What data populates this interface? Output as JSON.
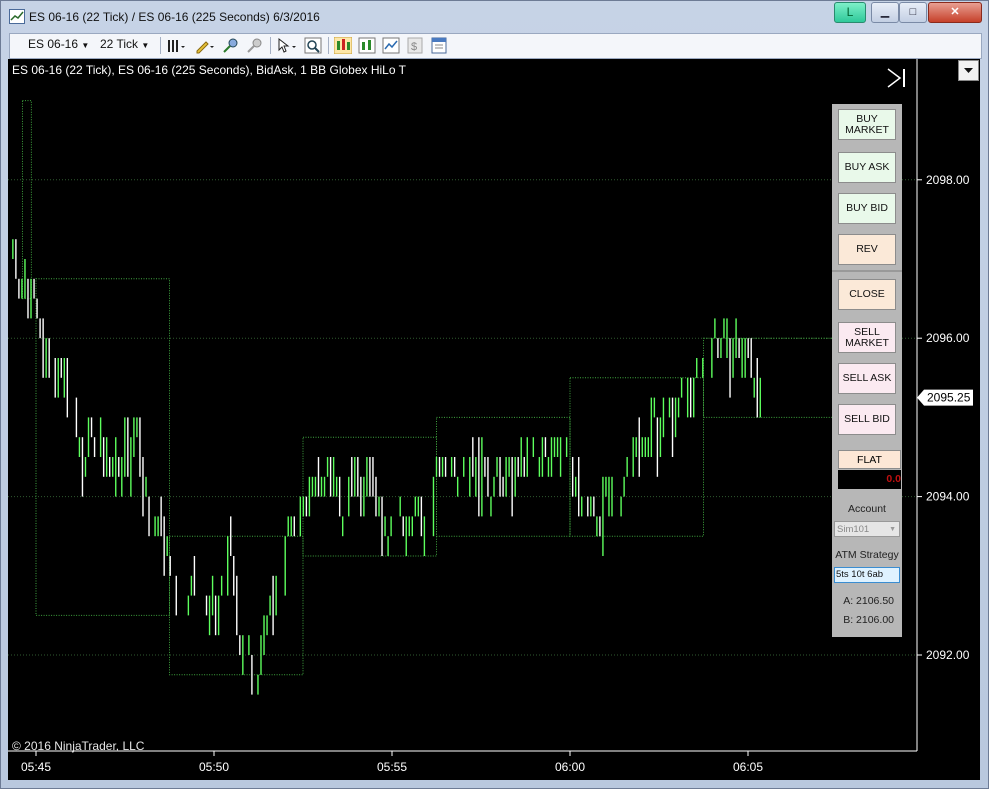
{
  "window": {
    "title": "ES 06-16 (22 Tick) / ES 06-16 (225 Seconds)  6/3/2016",
    "badge": "L",
    "controls": {
      "minimize": "▁",
      "maximize": "□",
      "close": "✕"
    }
  },
  "toolbar": {
    "instrument": "ES 06-16",
    "interval": "22 Tick",
    "icons": [
      "bar-style-icon",
      "pencil-draw-icon",
      "zoom-in-icon",
      "zoom-out-icon",
      "pointer-icon",
      "magnify-icon",
      "chart-trader-icon",
      "indicators-icon",
      "strategies-icon",
      "dollar-icon",
      "properties-icon"
    ]
  },
  "chart_header": "ES 06-16 (22 Tick), ES 06-16 (225 Seconds), BidAsk, 1 BB Globex HiLo T",
  "copyright": "© 2016 NinjaTrader, LLC",
  "chart_trader": {
    "buy_market": "BUY MARKET",
    "buy_ask": "BUY ASK",
    "buy_bid": "BUY BID",
    "rev": "REV",
    "close": "CLOSE",
    "sell_market": "SELL MARKET",
    "sell_ask": "SELL ASK",
    "sell_bid": "SELL BID",
    "flat": "FLAT",
    "pnl": "0.0",
    "account_label": "Account",
    "account_value": "Sim101",
    "atm_label": "ATM Strategy",
    "atm_value": "5ts 10t  6ab",
    "ask_quote": "A: 2106.50",
    "bid_quote": "B: 2106.00"
  },
  "colors": {
    "up": "#5dff5d",
    "down": "#ffffff",
    "box": "#3fa53f",
    "grid": "#2f5a2f",
    "background": "#000000"
  },
  "chart_data": {
    "type": "bar",
    "title": "ES 06-16 (22 Tick), ES 06-16 (225 Seconds), BidAsk, 1 BB Globex HiLo T",
    "ylim": [
      2090.7,
      2100.0
    ],
    "y_ticks": [
      2092.0,
      2094.0,
      2096.0,
      2098.0
    ],
    "y_tick_labels": [
      "2092.00",
      "2094.00",
      "2096.00",
      "2098.00"
    ],
    "x_ticks": [
      "05:45",
      "05:50",
      "05:55",
      "06:00",
      "06:05"
    ],
    "x_tick_minutes": [
      45.0,
      50.0,
      55.0,
      60.0,
      65.0
    ],
    "last_price": 2095.25,
    "last_price_label": "2095.25",
    "grid": true,
    "boxes_225s": [
      {
        "start_min": 44.62,
        "end_min": 44.87,
        "low": 2096.5,
        "high": 2099.0
      },
      {
        "start_min": 45.0,
        "end_min": 48.75,
        "low": 2092.5,
        "high": 2096.75
      },
      {
        "start_min": 48.75,
        "end_min": 52.5,
        "low": 2091.75,
        "high": 2093.5
      },
      {
        "start_min": 52.5,
        "end_min": 56.25,
        "low": 2093.25,
        "high": 2094.75
      },
      {
        "start_min": 56.25,
        "end_min": 60.0,
        "low": 2093.5,
        "high": 2095.0
      },
      {
        "start_min": 60.0,
        "end_min": 63.75,
        "low": 2093.5,
        "high": 2095.5
      },
      {
        "start_min": 63.75,
        "end_min": 67.5,
        "low": 2095.0,
        "high": 2096.0
      }
    ],
    "tick_path": [
      {
        "t": 44.35,
        "p": 2097.25
      },
      {
        "t": 44.6,
        "p": 2096.5
      },
      {
        "t": 44.9,
        "p": 2096.75
      },
      {
        "t": 45.2,
        "p": 2095.75
      },
      {
        "t": 45.8,
        "p": 2095.5
      },
      {
        "t": 46.3,
        "p": 2094.5
      },
      {
        "t": 46.6,
        "p": 2094.75
      },
      {
        "t": 47.2,
        "p": 2094.25
      },
      {
        "t": 47.8,
        "p": 2094.75
      },
      {
        "t": 48.2,
        "p": 2093.75
      },
      {
        "t": 48.6,
        "p": 2093.5
      },
      {
        "t": 49.0,
        "p": 2092.5
      },
      {
        "t": 49.6,
        "p": 2092.75
      },
      {
        "t": 50.1,
        "p": 2092.5
      },
      {
        "t": 50.4,
        "p": 2093.25
      },
      {
        "t": 50.8,
        "p": 2092.0
      },
      {
        "t": 51.0,
        "p": 2091.75
      },
      {
        "t": 51.4,
        "p": 2092.25
      },
      {
        "t": 51.8,
        "p": 2093.0
      },
      {
        "t": 52.3,
        "p": 2093.75
      },
      {
        "t": 52.6,
        "p": 2094.0
      },
      {
        "t": 53.0,
        "p": 2094.25
      },
      {
        "t": 53.6,
        "p": 2094.0
      },
      {
        "t": 54.2,
        "p": 2094.25
      },
      {
        "t": 54.8,
        "p": 2093.75
      },
      {
        "t": 55.3,
        "p": 2093.75
      },
      {
        "t": 55.8,
        "p": 2093.5
      },
      {
        "t": 56.3,
        "p": 2094.25
      },
      {
        "t": 57.0,
        "p": 2094.5
      },
      {
        "t": 57.8,
        "p": 2094.25
      },
      {
        "t": 58.5,
        "p": 2094.25
      },
      {
        "t": 59.2,
        "p": 2094.5
      },
      {
        "t": 59.8,
        "p": 2094.75
      },
      {
        "t": 60.2,
        "p": 2094.0
      },
      {
        "t": 60.8,
        "p": 2093.75
      },
      {
        "t": 61.2,
        "p": 2093.75
      },
      {
        "t": 61.6,
        "p": 2094.5
      },
      {
        "t": 62.3,
        "p": 2094.75
      },
      {
        "t": 62.8,
        "p": 2095.0
      },
      {
        "t": 63.3,
        "p": 2095.25
      },
      {
        "t": 63.8,
        "p": 2095.5
      },
      {
        "t": 64.0,
        "p": 2096.0
      },
      {
        "t": 64.6,
        "p": 2095.75
      },
      {
        "t": 65.0,
        "p": 2095.75
      },
      {
        "t": 65.4,
        "p": 2095.25
      }
    ]
  }
}
